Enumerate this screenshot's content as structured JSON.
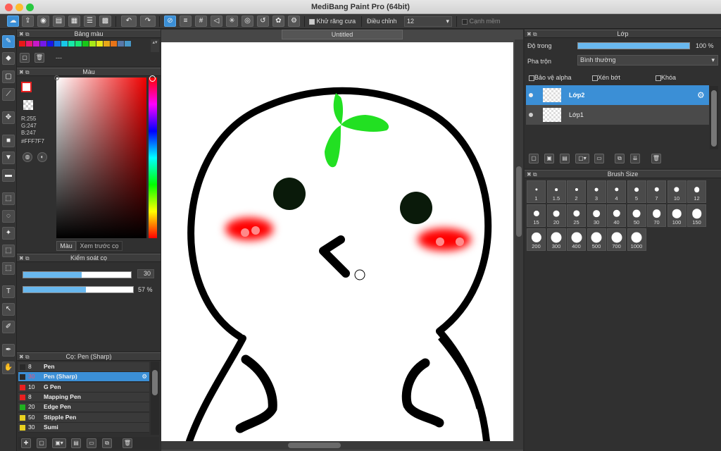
{
  "window": {
    "title": "MediBang Paint Pro (64bit)"
  },
  "toolbar": {
    "antialias_label": "Khử răng cưa",
    "adjust_label": "Điều chỉnh",
    "adjust_value": "12",
    "soft_edge_label": "Cạnh mềm"
  },
  "palette_panel": {
    "title": "Bảng màu",
    "empty_label": "---",
    "swatches": [
      "#e81818",
      "#e81874",
      "#c818c8",
      "#7418e8",
      "#1818e8",
      "#1874e8",
      "#18c8e8",
      "#18e8a8",
      "#18e874",
      "#18c818",
      "#a8e818",
      "#e8e818",
      "#e8a818",
      "#e87418",
      "#5878a8",
      "#4898c8"
    ]
  },
  "color_panel": {
    "title": "Màu",
    "r": "R:255",
    "g": "G:247",
    "b": "B:247",
    "hex": "#FFF7F7",
    "tab_color": "Màu",
    "tab_preview": "Xem trước cọ"
  },
  "brush_control": {
    "title": "Kiểm soát cọ",
    "size": "30",
    "size_fill": 0.54,
    "opacity": "57 %",
    "opacity_fill": 0.57
  },
  "brush_list": {
    "title": "Cọ: Pen (Sharp)",
    "items": [
      {
        "size": "8",
        "name": "Pen",
        "color": "#2a2a2a"
      },
      {
        "size": "30",
        "name": "Pen (Sharp)",
        "color": "#2a2a2a",
        "selected": true
      },
      {
        "size": "10",
        "name": "G Pen",
        "color": "#e82020"
      },
      {
        "size": "8",
        "name": "Mapping Pen",
        "color": "#e82020"
      },
      {
        "size": "20",
        "name": "Edge Pen",
        "color": "#20b020"
      },
      {
        "size": "50",
        "name": "Stipple Pen",
        "color": "#e8d020"
      },
      {
        "size": "30",
        "name": "Sumi",
        "color": "#e8d020"
      }
    ]
  },
  "canvas": {
    "tab": "Untitled"
  },
  "layer_panel": {
    "title": "Lớp",
    "opacity_label": "Độ trong",
    "opacity_value": "100 %",
    "opacity_fill": 1.0,
    "blend_label": "Pha trộn",
    "blend_value": "Bình thường",
    "alpha_protect": "Bảo vệ alpha",
    "clipping": "Xén bớt",
    "lock": "Khóa",
    "layers": [
      {
        "name": "Lớp2",
        "selected": true
      },
      {
        "name": "Lớp1",
        "selected": false
      }
    ]
  },
  "brush_size_panel": {
    "title": "Brush Size",
    "sizes": [
      "1",
      "1.5",
      "2",
      "3",
      "4",
      "5",
      "7",
      "10",
      "12",
      "15",
      "20",
      "25",
      "30",
      "40",
      "50",
      "70",
      "100",
      "150",
      "200",
      "300",
      "400",
      "500",
      "700",
      "1000"
    ]
  }
}
